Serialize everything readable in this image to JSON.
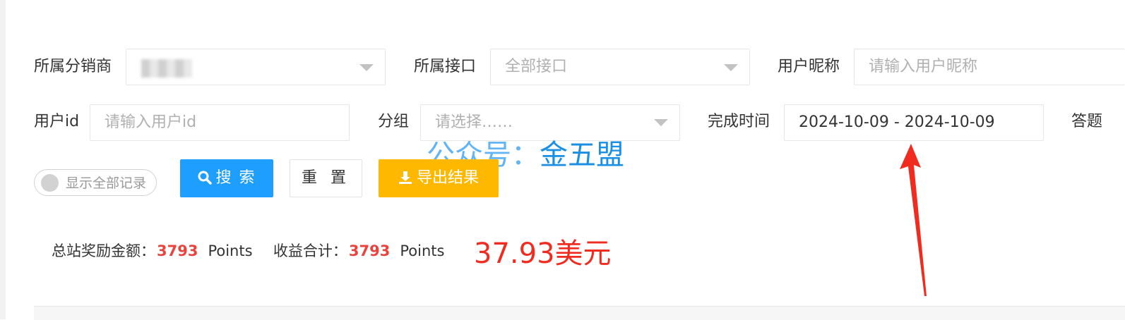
{
  "filters": {
    "distributor": {
      "label": "所属分销商",
      "value": ""
    },
    "interface": {
      "label": "所属接口",
      "value": "全部接口"
    },
    "nickname": {
      "label": "用户昵称",
      "placeholder": "请输入用户昵称"
    },
    "user_id": {
      "label": "用户id",
      "placeholder": "请输入用户id"
    },
    "group": {
      "label": "分组",
      "placeholder": "请选择……"
    },
    "finish_time": {
      "label": "完成时间",
      "value": "2024-10-09 - 2024-10-09"
    },
    "answer_partial_label": "答题"
  },
  "actions": {
    "show_all_label": "显示全部记录",
    "search_label": "搜 索",
    "reset_label": "重 置",
    "export_label": "导出结果"
  },
  "watermark": {
    "prefix": "公众号：",
    "name": "金五盟"
  },
  "summary": {
    "total_reward_label": "总站奖励金额：",
    "total_reward_value": "3793",
    "total_reward_unit": "Points",
    "income_label": "收益合计：",
    "income_value": "3793",
    "income_unit": "Points",
    "usd_annotation": "37.93美元"
  },
  "colors": {
    "primary": "#1e9fff",
    "warning": "#ffb800",
    "amount_red": "#e8443f",
    "annotation_red": "#f02b1f",
    "watermark_blue": "#1a8fe3"
  }
}
